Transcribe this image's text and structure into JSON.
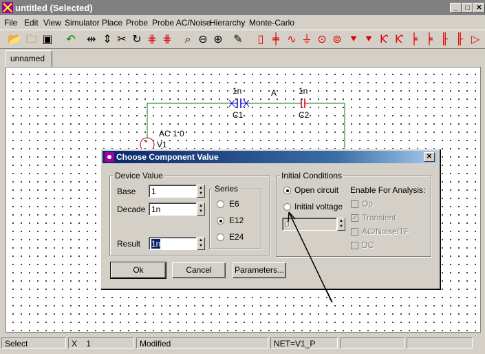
{
  "window": {
    "title": "untitled (Selected)"
  },
  "menu": [
    "File",
    "Edit",
    "View",
    "Simulator",
    "Place",
    "Probe",
    "Probe AC/Noise",
    "Hierarchy",
    "Monte-Carlo"
  ],
  "toolbar_icons": [
    "open-folder",
    "new-folder",
    "save",
    "undo",
    "flip-horizontal",
    "flip-vertical",
    "cut",
    "rotate",
    "delete-wire",
    "delete-node",
    "zoom-fit",
    "zoom-out",
    "zoom-in",
    "pencil",
    "resistor",
    "capacitor",
    "inductor",
    "ground",
    "voltage-source",
    "current-source",
    "diode",
    "zener",
    "npn",
    "pnp",
    "nmos",
    "pmos",
    "jfet",
    "opamp"
  ],
  "tab": {
    "label": "unnamed"
  },
  "schematic": {
    "c1_value": "1n",
    "c1_name": "C1",
    "c2_value": "1n",
    "c2_name": "C2",
    "node_label": "A",
    "v1_source": "AC 1 0",
    "v1_name": "V1"
  },
  "dialog": {
    "title": "Choose Component Value",
    "device_value_label": "Device Value",
    "base_label": "Base",
    "base_value": "1",
    "decade_label": "Decade",
    "decade_value": "1n",
    "result_label": "Result",
    "result_value": "1n",
    "series_label": "Series",
    "series": [
      {
        "label": "E6",
        "selected": false
      },
      {
        "label": "E12",
        "selected": true
      },
      {
        "label": "E24",
        "selected": false
      }
    ],
    "initial_conditions_label": "Initial Conditions",
    "open_circuit_label": "Open circuit",
    "initial_voltage_label": "Initial voltage",
    "initial_voltage_value": "0",
    "enable_label": "Enable For Analysis:",
    "analyses": [
      {
        "label": "Op",
        "checked": false
      },
      {
        "label": "Transient",
        "checked": true
      },
      {
        "label": "AC/Noise/TF",
        "checked": false
      },
      {
        "label": "DC",
        "checked": false
      }
    ],
    "ok_label": "Ok",
    "cancel_label": "Cancel",
    "parameters_label": "Parameters..."
  },
  "status": {
    "mode": "Select",
    "x": "X    1",
    "state": "Modified",
    "net": "NET=V1_P"
  },
  "colors": {
    "wire": "#008000",
    "component": "#0000c0",
    "toolbar_red": "#e00000",
    "title_active": "#0a246a"
  }
}
